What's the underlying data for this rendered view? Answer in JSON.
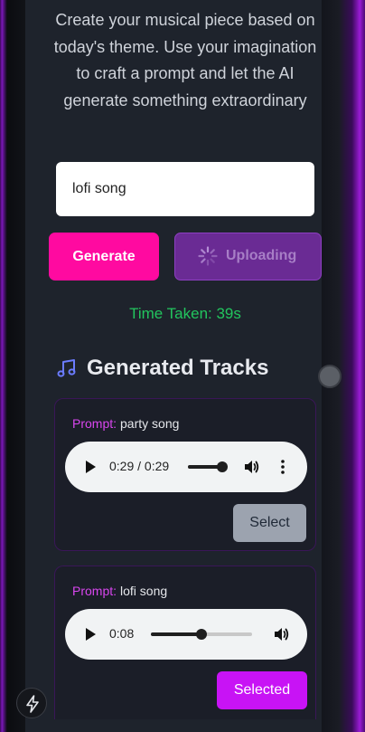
{
  "intro": {
    "text": "Create your musical piece based on today's theme. Use your imagination to craft a prompt and let the AI generate something extraordinary"
  },
  "prompt_input": {
    "value": "lofi song"
  },
  "actions": {
    "generate_label": "Generate",
    "uploading_label": "Uploading"
  },
  "status": {
    "time_taken": "Time Taken: 39s"
  },
  "tracks_section": {
    "heading": "Generated Tracks",
    "icon": "music-note-icon"
  },
  "tracks": [
    {
      "prompt_label": "Prompt:",
      "prompt": "party song",
      "time": "0:29 / 0:29",
      "progress": 1.0,
      "button_label": "Select"
    },
    {
      "prompt_label": "Prompt:",
      "prompt": "lofi song",
      "time": "0:08",
      "progress": 0.5,
      "button_label": "Selected"
    }
  ],
  "colors": {
    "accent_pink": "#ff0aa0",
    "accent_purple": "#c813f5",
    "success_green": "#22c55e",
    "panel_bg": "#1e232c"
  }
}
